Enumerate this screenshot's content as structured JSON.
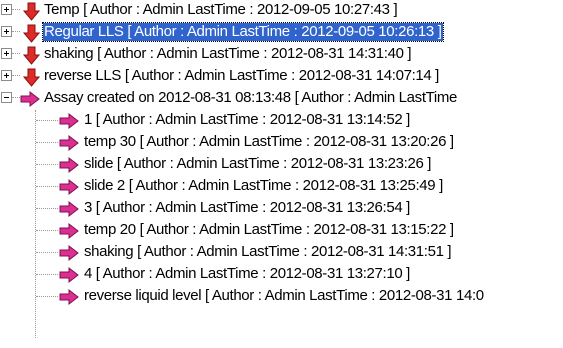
{
  "tree": {
    "roots": [
      {
        "label": "Temp [ Author : Admin      LastTime : 2012-09-05 10:27:43 ]",
        "icon": "down-arrow-icon",
        "expander": "plus",
        "selected": false
      },
      {
        "label": "Regular LLS [ Author : Admin      LastTime : 2012-09-05 10:26:13 ]",
        "icon": "down-arrow-icon",
        "expander": "plus",
        "selected": true
      },
      {
        "label": "shaking [ Author : Admin      LastTime : 2012-08-31 14:31:40 ]",
        "icon": "down-arrow-icon",
        "expander": "plus",
        "selected": false
      },
      {
        "label": "reverse LLS [ Author : Admin      LastTime : 2012-08-31 14:07:14 ]",
        "icon": "down-arrow-icon",
        "expander": "plus",
        "selected": false
      },
      {
        "label": "Assay created on 2012-08-31 08:13:48 [ Author : Admin      LastTime",
        "icon": "right-arrow-icon",
        "expander": "minus",
        "selected": false
      }
    ],
    "children": [
      {
        "label": "1 [ Author : Admin      LastTime : 2012-08-31 13:14:52 ]",
        "icon": "right-arrow-icon"
      },
      {
        "label": "temp 30 [ Author : Admin      LastTime : 2012-08-31 13:20:26 ]",
        "icon": "right-arrow-icon"
      },
      {
        "label": "slide [ Author : Admin      LastTime : 2012-08-31 13:23:26 ]",
        "icon": "right-arrow-icon"
      },
      {
        "label": "slide 2 [ Author : Admin      LastTime : 2012-08-31 13:25:49 ]",
        "icon": "right-arrow-icon"
      },
      {
        "label": "3 [ Author : Admin      LastTime : 2012-08-31 13:26:54 ]",
        "icon": "right-arrow-icon"
      },
      {
        "label": "temp 20 [ Author : Admin      LastTime : 2012-08-31 13:15:22 ]",
        "icon": "right-arrow-icon"
      },
      {
        "label": "shaking [ Author : Admin      LastTime : 2012-08-31 14:31:51 ]",
        "icon": "right-arrow-icon"
      },
      {
        "label": "4 [ Author : Admin      LastTime : 2012-08-31 13:27:10 ]",
        "icon": "right-arrow-icon"
      },
      {
        "label": "reverse liquid level [ Author : Admin      LastTime : 2012-08-31 14:0",
        "icon": "right-arrow-icon"
      }
    ]
  },
  "colors": {
    "selection_background": "#2f63ce",
    "selection_text": "#ffffff",
    "down_arrow_fill": "#dd2a2a",
    "right_arrow_fill": "#dc2f91",
    "tree_lines": "#9a9a9a"
  }
}
